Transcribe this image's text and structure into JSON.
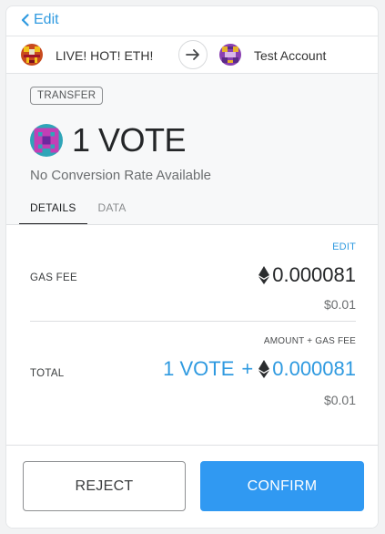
{
  "header": {
    "back_label": "Edit"
  },
  "accounts": {
    "from_name": "LIVE! HOT! ETH!",
    "to_name": "Test Account"
  },
  "summary": {
    "badge": "TRANSFER",
    "amount": "1 VOTE",
    "conversion": "No Conversion Rate Available",
    "tabs": [
      {
        "label": "DETAILS",
        "active": true
      },
      {
        "label": "DATA",
        "active": false
      }
    ]
  },
  "details": {
    "edit_label": "EDIT",
    "gas_fee_label": "GAS FEE",
    "gas_fee_eth": "0.000081",
    "gas_fee_usd": "$0.01",
    "amount_gas_label": "AMOUNT + GAS FEE",
    "total_label": "TOTAL",
    "total_token": "1 VOTE",
    "total_plus": "+",
    "total_eth": "0.000081",
    "total_usd": "$0.01"
  },
  "footer": {
    "reject_label": "REJECT",
    "confirm_label": "CONFIRM"
  },
  "colors": {
    "accent": "#2f9ae0",
    "confirm_bg": "#3099f2"
  }
}
